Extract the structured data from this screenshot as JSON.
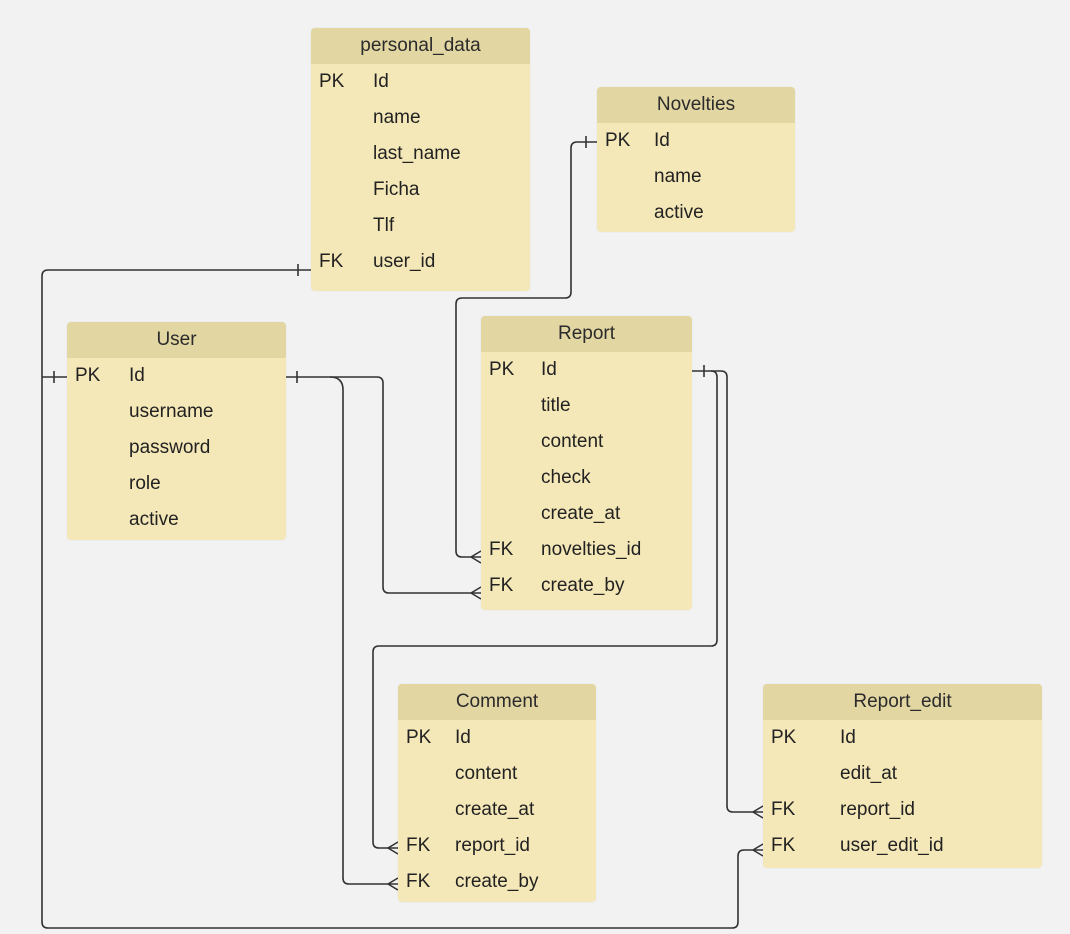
{
  "entities": {
    "personal_data": {
      "title": "personal_data",
      "rows": [
        {
          "key": "PK",
          "name": "Id"
        },
        {
          "key": "",
          "name": "name"
        },
        {
          "key": "",
          "name": "last_name"
        },
        {
          "key": "",
          "name": "Ficha"
        },
        {
          "key": "",
          "name": "Tlf"
        },
        {
          "key": "FK",
          "name": "user_id"
        }
      ]
    },
    "novelties": {
      "title": "Novelties",
      "rows": [
        {
          "key": "PK",
          "name": "Id"
        },
        {
          "key": "",
          "name": "name"
        },
        {
          "key": "",
          "name": "active"
        }
      ]
    },
    "user": {
      "title": "User",
      "rows": [
        {
          "key": "PK",
          "name": "Id"
        },
        {
          "key": "",
          "name": "username"
        },
        {
          "key": "",
          "name": "password"
        },
        {
          "key": "",
          "name": "role"
        },
        {
          "key": "",
          "name": "active"
        }
      ]
    },
    "report": {
      "title": "Report",
      "rows": [
        {
          "key": "PK",
          "name": "Id"
        },
        {
          "key": "",
          "name": "title"
        },
        {
          "key": "",
          "name": "content"
        },
        {
          "key": "",
          "name": "check"
        },
        {
          "key": "",
          "name": "create_at"
        },
        {
          "key": "FK",
          "name": "novelties_id"
        },
        {
          "key": "FK",
          "name": "create_by"
        }
      ]
    },
    "comment": {
      "title": "Comment",
      "rows": [
        {
          "key": "PK",
          "name": "Id"
        },
        {
          "key": "",
          "name": "content"
        },
        {
          "key": "",
          "name": "create_at"
        },
        {
          "key": "FK",
          "name": "report_id"
        },
        {
          "key": "FK",
          "name": "create_by"
        }
      ]
    },
    "report_edit": {
      "title": "Report_edit",
      "rows": [
        {
          "key": "PK",
          "name": "Id"
        },
        {
          "key": "",
          "name": "edit_at"
        },
        {
          "key": "FK",
          "name": "report_id"
        },
        {
          "key": "FK",
          "name": "user_edit_id"
        }
      ]
    }
  },
  "colors": {
    "background": "#f2f2f2",
    "entity_body": "#f5e8b8",
    "entity_header": "#e2d6a3",
    "line": "#333333"
  }
}
